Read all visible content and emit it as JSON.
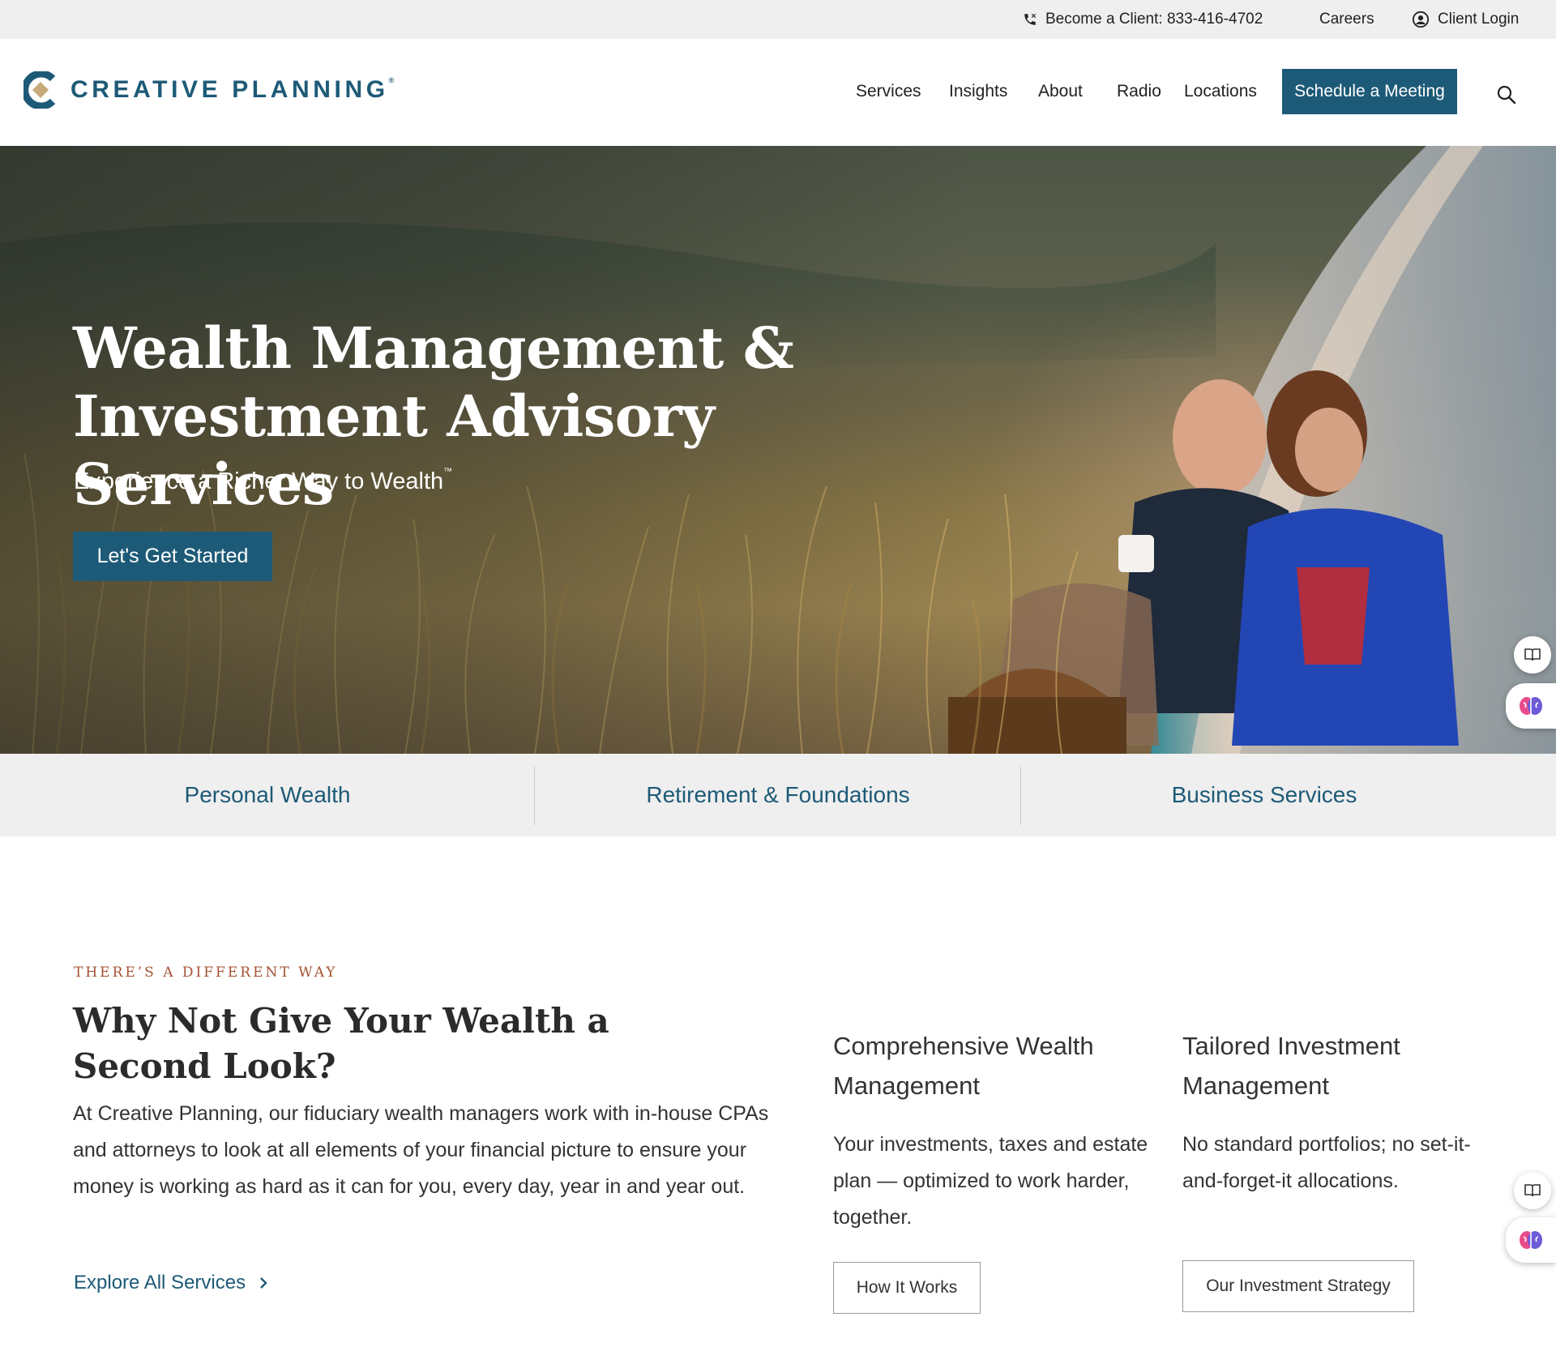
{
  "utility_bar": {
    "phone_label": "Become a Client: 833-416-4702",
    "careers": "Careers",
    "client_login": "Client Login"
  },
  "header": {
    "logo_text": "CREATIVE PLANNING",
    "logo_mark": "®",
    "nav": [
      "Services",
      "Insights",
      "About",
      "Radio",
      "Locations"
    ],
    "cta": "Schedule a Meeting",
    "search_icon": "search-icon"
  },
  "hero": {
    "title_line1": "Wealth Management &",
    "title_line2": "Investment Advisory Services",
    "subtitle": "Experience a Richer Way to Wealth",
    "subtitle_mark": "™",
    "button": "Let's Get Started"
  },
  "categories": [
    "Personal Wealth",
    "Retirement & Foundations",
    "Business Services"
  ],
  "section": {
    "eyebrow": "THERE’S A DIFFERENT WAY",
    "title": "Why Not Give Your Wealth a Second Look?",
    "body": "At Creative Planning, our fiduciary wealth managers work with in-house CPAs and attorneys to look at all elements of your financial picture to ensure your money is working as hard as it can for you, every day, year in and year out.",
    "link": "Explore All Services"
  },
  "columns": [
    {
      "title": "Comprehensive Wealth Management",
      "body": "Your investments, taxes and estate plan — optimized to work harder, together.",
      "button": "How It Works"
    },
    {
      "title": "Tailored Investment Management",
      "body": "No standard portfolios; no set-it-and-forget-it allocations.",
      "button": "Our Investment Strategy"
    }
  ],
  "colors": {
    "brand_blue": "#1d5a77",
    "accent_gold": "#b99a6a",
    "eyebrow_rust": "#a55233",
    "strip_gray": "#efefef"
  }
}
